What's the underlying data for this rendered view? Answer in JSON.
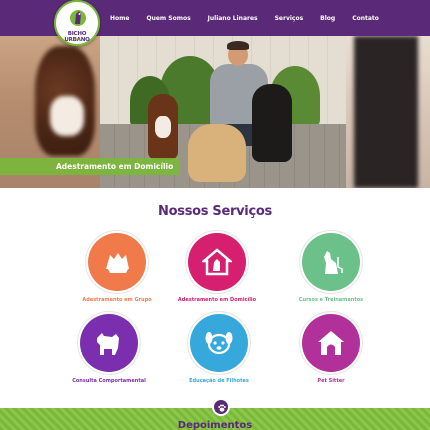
{
  "logo": {
    "text": "BICHO URBANO",
    "subtext": "dog"
  },
  "nav": {
    "items": [
      "Home",
      "Quem Somos",
      "Juliano Linares",
      "Serviços",
      "Blog",
      "Contato"
    ]
  },
  "hero": {
    "banner_text": "Adestramento em Domicílio"
  },
  "services_section": {
    "title": "Nossos Serviços",
    "items": [
      {
        "label": "Adestramento em Grupo",
        "color": "#f07a4a",
        "icon": "dogs-group-icon"
      },
      {
        "label": "Adestramento em Domicílio",
        "color": "#d61f6e",
        "icon": "house-dog-icon"
      },
      {
        "label": "Cursos e Treinamentos",
        "color": "#6cc08a",
        "icon": "sitting-dog-icon"
      },
      {
        "label": "Consulta Comportamental",
        "color": "#7b2fae",
        "icon": "dog-profile-icon"
      },
      {
        "label": "Educação de Filhotes",
        "color": "#36a8dc",
        "icon": "puppy-face-icon"
      },
      {
        "label": "Pet Sitter",
        "color": "#b2309a",
        "icon": "doghouse-icon"
      }
    ]
  },
  "footer_band": {
    "title": "Depoimentos",
    "badge_icon": "paw-icon"
  },
  "colors": {
    "header": "#5a2a78",
    "accent_green": "#7ab83a"
  }
}
